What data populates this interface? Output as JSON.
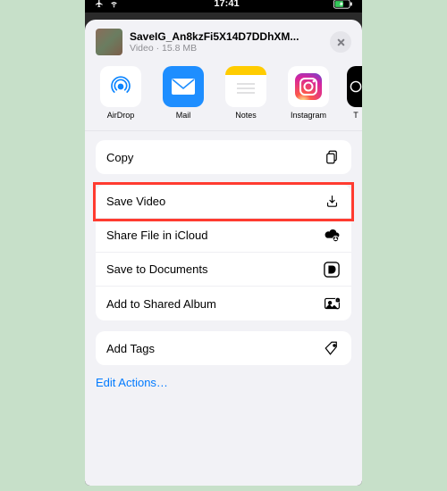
{
  "status": {
    "time": "17:41"
  },
  "file": {
    "title": "SaveIG_An8kzFi5X14D7DDhXM...",
    "subtitle": "Video · 15.8 MB"
  },
  "share_targets": [
    {
      "name": "airdrop",
      "label": "AirDrop"
    },
    {
      "name": "mail",
      "label": "Mail"
    },
    {
      "name": "notes",
      "label": "Notes"
    },
    {
      "name": "instagram",
      "label": "Instagram"
    },
    {
      "name": "more",
      "label": "T"
    }
  ],
  "actions": {
    "copy": "Copy",
    "save_video": "Save Video",
    "share_icloud": "Share File in iCloud",
    "save_documents": "Save to Documents",
    "add_shared_album": "Add to Shared Album",
    "add_tags": "Add Tags"
  },
  "edit_actions": "Edit Actions…"
}
